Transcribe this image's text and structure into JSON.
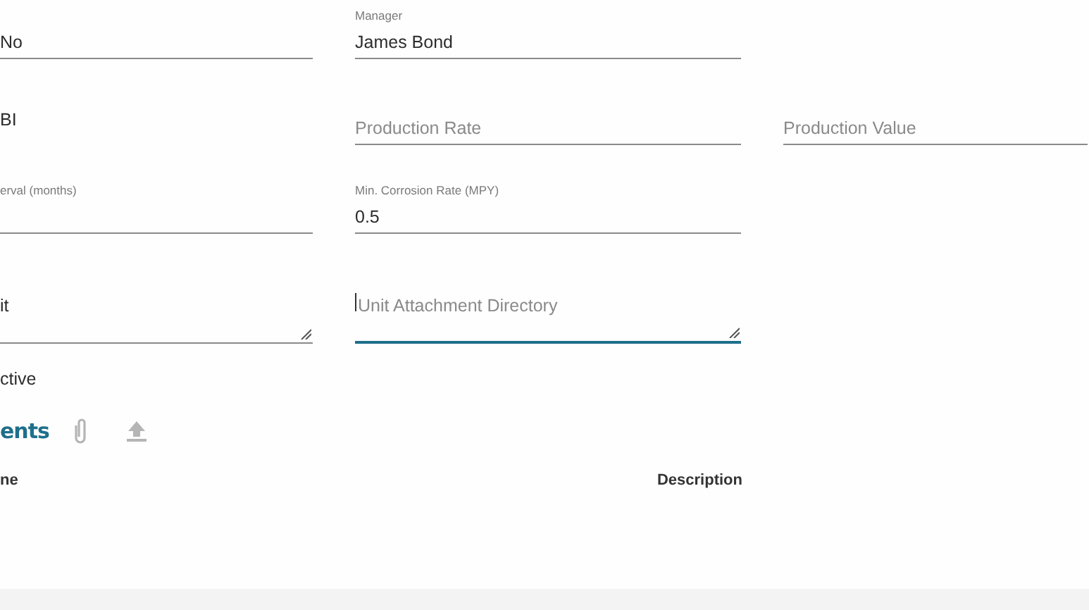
{
  "fields": [
    {
      "value": "No",
      "kind": "text",
      "focused": false
    },
    {
      "label": "Manager",
      "value": "James Bond",
      "kind": "text",
      "focused": false
    },
    {
      "kind": "empty"
    },
    {
      "value": "BI",
      "kind": "plain"
    },
    {
      "placeholder": "Production Rate",
      "kind": "text",
      "focused": false
    },
    {
      "placeholder": "Production Value",
      "kind": "text",
      "focused": false
    },
    {
      "label": "erval (months)",
      "kind": "text",
      "focused": false
    },
    {
      "label": "Min. Corrosion Rate (MPY)",
      "value": "0.5",
      "kind": "text",
      "focused": false
    },
    {
      "kind": "empty"
    },
    {
      "value": "it",
      "kind": "textarea",
      "focused": false
    },
    {
      "placeholder": "Unit Attachment Directory",
      "kind": "textarea",
      "focused": true
    }
  ],
  "active_label": "ctive",
  "attachments": {
    "title": "ents",
    "columns": [
      "ne",
      "Description"
    ]
  }
}
